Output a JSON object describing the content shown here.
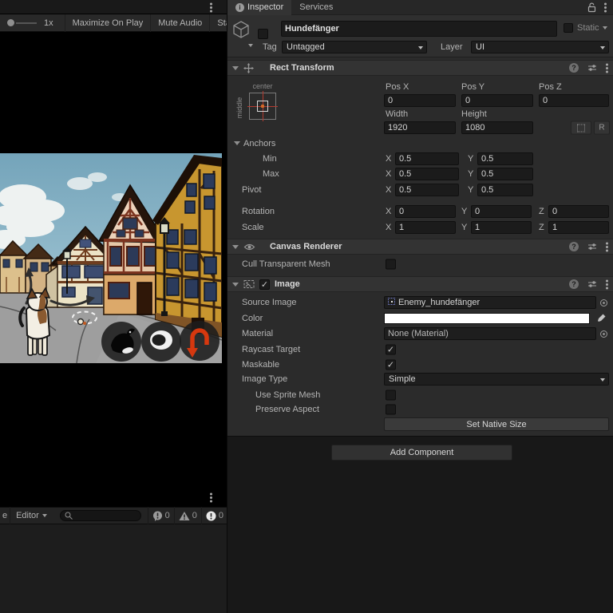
{
  "icons": {
    "help": "?",
    "info": "i",
    "check": "✓"
  },
  "game_panel": {
    "toolbar": {
      "scale_value": "1x",
      "maximize_label": "Maximize On Play",
      "mute_label": "Mute Audio",
      "stats_label": "Sta"
    },
    "scene": {
      "description": "cartoon half-timbered town street with dog, dashed target circle and three round action buttons",
      "sky_color": "#74a4ba",
      "street_color": "#9e9e9e",
      "timber_color": "#38220f",
      "uturn_arrow_color": "#d6380f"
    }
  },
  "console_bar": {
    "clipped_tab_text": "e",
    "editor_dropdown": "Editor",
    "search_value": "",
    "info_count": "0",
    "warning_count": "0",
    "error_count": "0"
  },
  "inspector": {
    "tab_inspector": "Inspector",
    "tab_services": "Services",
    "game_object": {
      "name": "Hundefänger",
      "static_label": "Static",
      "tag_label": "Tag",
      "tag_value": "Untagged",
      "layer_label": "Layer",
      "layer_value": "UI"
    },
    "rect_transform": {
      "title": "Rect Transform",
      "anchor_h": "center",
      "anchor_v": "middle",
      "pos_x_label": "Pos X",
      "pos_x": "0",
      "pos_y_label": "Pos Y",
      "pos_y": "0",
      "pos_z_label": "Pos Z",
      "pos_z": "0",
      "width_label": "Width",
      "width": "1920",
      "height_label": "Height",
      "height": "1080",
      "r_button": "R",
      "anchors_label": "Anchors",
      "min_label": "Min",
      "min_x": "0.5",
      "min_y": "0.5",
      "max_label": "Max",
      "max_x": "0.5",
      "max_y": "0.5",
      "pivot_label": "Pivot",
      "pivot_x": "0.5",
      "pivot_y": "0.5",
      "rotation_label": "Rotation",
      "rot_x": "0",
      "rot_y": "0",
      "rot_z": "0",
      "scale_label": "Scale",
      "scale_x": "1",
      "scale_y": "1",
      "scale_z": "1",
      "x_prefix": "X",
      "y_prefix": "Y",
      "z_prefix": "Z"
    },
    "canvas_renderer": {
      "title": "Canvas Renderer",
      "cull_label": "Cull Transparent Mesh"
    },
    "image": {
      "title": "Image",
      "source_label": "Source Image",
      "source_value": "Enemy_hundefänger",
      "color_label": "Color",
      "material_label": "Material",
      "material_value": "None (Material)",
      "raycast_label": "Raycast Target",
      "maskable_label": "Maskable",
      "type_label": "Image Type",
      "type_value": "Simple",
      "sprite_mesh_label": "Use Sprite Mesh",
      "preserve_label": "Preserve Aspect",
      "set_native_size_label": "Set Native Size"
    },
    "add_component_label": "Add Component"
  }
}
